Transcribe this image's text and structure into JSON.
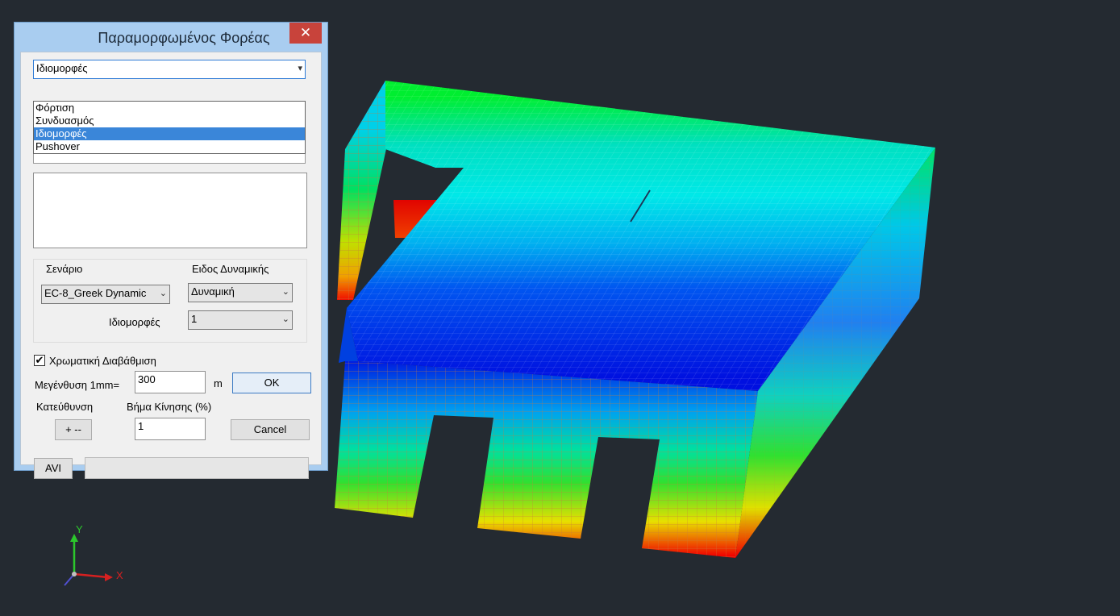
{
  "dialog": {
    "title": "Παραμορφωμένος Φορέας",
    "close_icon": "close-icon",
    "type_combo": {
      "selected": "Ιδιομορφές",
      "options": [
        "Φόρτιση",
        "Συνδυασμός",
        "Ιδιομορφές",
        "Pushover"
      ]
    },
    "scenario": {
      "label": "Σενάριο",
      "selected": "EC-8_Greek Dynamic"
    },
    "dynamic_type": {
      "label": "Ειδος Δυναμικής",
      "selected": "Δυναμική"
    },
    "modes": {
      "label": "Ιδιομορφές",
      "selected": "1"
    },
    "color_scale": {
      "label": "Χρωματική Διαβάθμιση",
      "checked": true
    },
    "magnification": {
      "label": "Μεγένθυση 1mm=",
      "value": "300",
      "unit": "m"
    },
    "ok_label": "OK",
    "direction": {
      "label": "Κατεύθυνση",
      "button": "+ --"
    },
    "step": {
      "label": "Βήμα Κίνησης (%)",
      "value": "1"
    },
    "cancel_label": "Cancel",
    "avi_label": "AVI"
  },
  "axes": {
    "x": "X",
    "y": "Y"
  },
  "colors": {
    "background": "#242a31",
    "mesh": "#c97a3a",
    "close": "#c8433b",
    "selection": "#3a86d9"
  }
}
